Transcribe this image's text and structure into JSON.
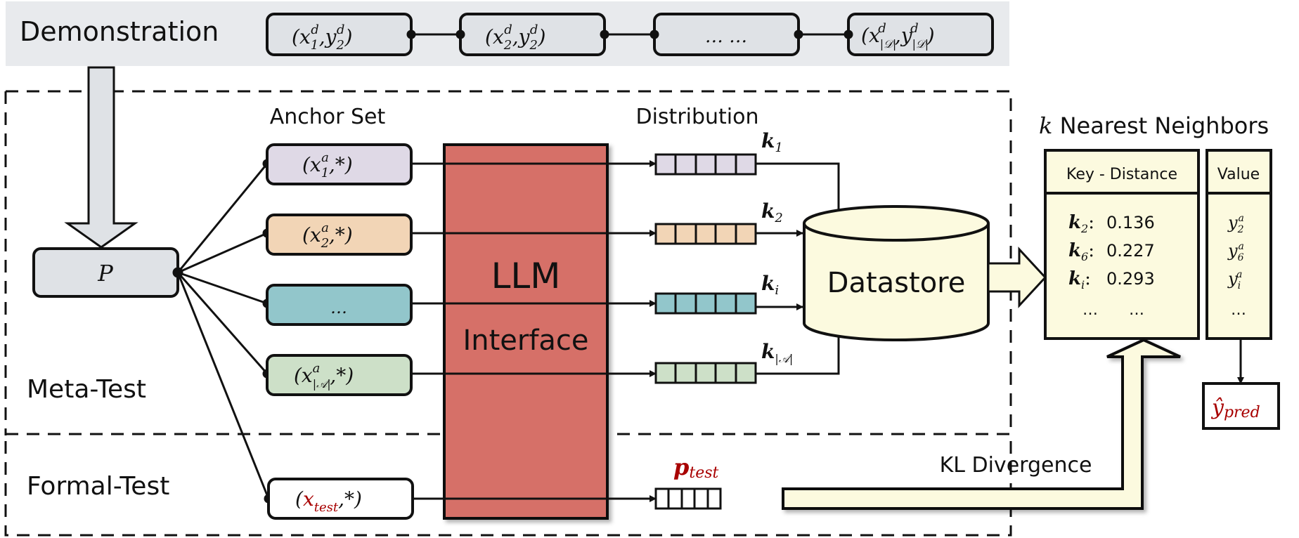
{
  "demonstration": {
    "label": "Demonstration",
    "items": [
      {
        "base_x": "x",
        "sub_x": "1",
        "sup": "d",
        "base_y": "y",
        "sub_y": "2"
      },
      {
        "base_x": "x",
        "sub_x": "2",
        "sup": "d",
        "base_y": "y",
        "sub_y": "2"
      },
      {
        "ellipsis": "… …"
      },
      {
        "base_x": "x",
        "sub_x": "|𝒟|",
        "sup": "d",
        "base_y": "y",
        "sub_y": "|𝒟|"
      }
    ]
  },
  "prompt": {
    "label": "P"
  },
  "anchor_set": {
    "title": "Anchor Set",
    "items": [
      {
        "sub": "1",
        "color": "#dfd9e6"
      },
      {
        "sub": "2",
        "color": "#f2d5b6"
      },
      {
        "ellipsis": "…",
        "color": "#92c6cb"
      },
      {
        "sub": "|𝒜|",
        "color": "#cde0c8"
      }
    ],
    "test_item": {
      "base": "x",
      "sub": "test",
      "star": ",*)"
    }
  },
  "llm": {
    "line1": "LLM",
    "line2": "Interface",
    "color": "#d66f67"
  },
  "distribution": {
    "title": "Distribution",
    "keys": [
      {
        "k": "k",
        "sub": "1"
      },
      {
        "k": "k",
        "sub": "2"
      },
      {
        "k": "k",
        "sub": "i"
      },
      {
        "k": "k",
        "sub": "|𝒜|"
      }
    ],
    "test_label": {
      "p": "p",
      "sub": "test"
    }
  },
  "datastore": {
    "label": "Datastore",
    "color": "#fcfadf"
  },
  "knn": {
    "title_k": "k",
    "title_rest": " Nearest Neighbors",
    "key_header": "Key - Distance",
    "value_header": "Value",
    "rows": [
      {
        "key_sub": "2",
        "distance": "0.136",
        "value_sub": "2"
      },
      {
        "key_sub": "6",
        "distance": "0.227",
        "value_sub": "6"
      },
      {
        "key_sub": "i",
        "distance": "0.293",
        "value_sub": "i"
      }
    ],
    "ellipsis": "…"
  },
  "kl": {
    "label": "KL Divergence"
  },
  "prediction": {
    "base": "ŷ",
    "sub": "pred"
  },
  "sections": {
    "meta_test": "Meta-Test",
    "formal_test": "Formal-Test"
  },
  "colors": {
    "accent_red": "#a80000",
    "demo_band": "#e8eaed",
    "box_gray": "#dfe2e6"
  }
}
